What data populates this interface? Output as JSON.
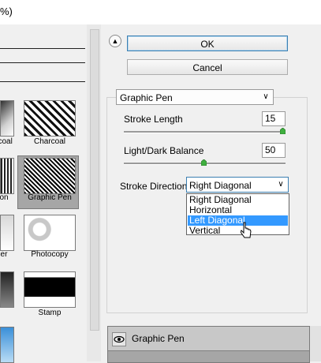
{
  "window": {
    "title_fragment": "%)"
  },
  "gallery": {
    "thumbnails": [
      {
        "label": "rcoal"
      },
      {
        "label": "Charcoal"
      },
      {
        "label": "on"
      },
      {
        "label": "Graphic Pen"
      },
      {
        "label": "er"
      },
      {
        "label": "Photocopy"
      },
      {
        "label": "Stamp"
      }
    ]
  },
  "dialog": {
    "ok_label": "OK",
    "cancel_label": "Cancel",
    "filter_select_value": "Graphic Pen",
    "stroke_length": {
      "label": "Stroke Length",
      "value": "15",
      "level": 1.0
    },
    "balance": {
      "label": "Light/Dark Balance",
      "value": "50",
      "level": 0.5
    },
    "stroke_direction": {
      "label": "Stroke Direction:",
      "value": "Right Diagonal",
      "options": [
        "Right Diagonal",
        "Horizontal",
        "Left Diagonal",
        "Vertical"
      ],
      "highlighted": "Left Diagonal"
    }
  },
  "layers": {
    "item_name": "Graphic Pen"
  },
  "colors": {
    "accent": "#3399ff",
    "focus_border": "#3c7fb1",
    "selected_thumb_bg": "#a6a6a6"
  }
}
